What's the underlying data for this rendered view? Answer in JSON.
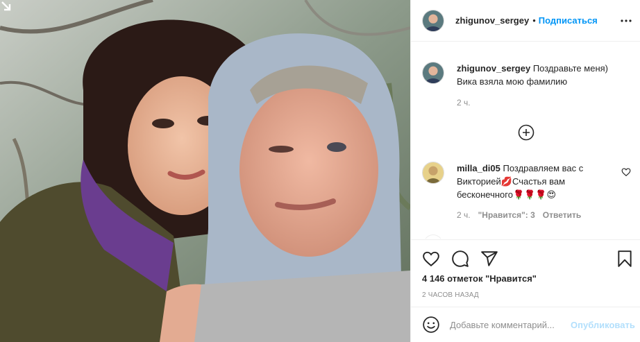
{
  "photo": {
    "description_icon": "carousel-arrow-icon",
    "colors": {
      "background": "#7d8a86",
      "hood": "#a9b7c8",
      "purple_scarf": "#6a3d8f",
      "coat": "#4e4a2c"
    }
  },
  "header": {
    "username": "zhigunov_sergey",
    "separator": "•",
    "follow_label": "Подписаться",
    "more_icon": "more-options-icon"
  },
  "caption": {
    "username": "zhigunov_sergey",
    "text_line1": " Поздравьте меня)",
    "text_line2": "Вика взяла мою фамилию",
    "time": "2 ч."
  },
  "load_more_icon": "plus-circle-icon",
  "comment": {
    "username": "milla_di05",
    "text_part1": " Поздравляем вас с Викторией",
    "emoji1": "💋",
    "text_part2": "Счастья вам бесконечного",
    "emoji2": "🌹🌹🌹😍",
    "time": "2 ч.",
    "likes_label": "\"Нравится\": 3",
    "reply_label": "Ответить"
  },
  "actions": {
    "like_icon": "heart-icon",
    "comment_icon": "comment-icon",
    "share_icon": "share-icon",
    "save_icon": "bookmark-icon"
  },
  "likes": {
    "count": "4 146 отметок ",
    "word": "\"Нравится\""
  },
  "time_ago": "2 часов назад",
  "add_comment": {
    "emoji_icon": "smiley-icon",
    "placeholder": "Добавьте комментарий...",
    "publish_label": "Опубликовать"
  },
  "accent": "#0095f6"
}
